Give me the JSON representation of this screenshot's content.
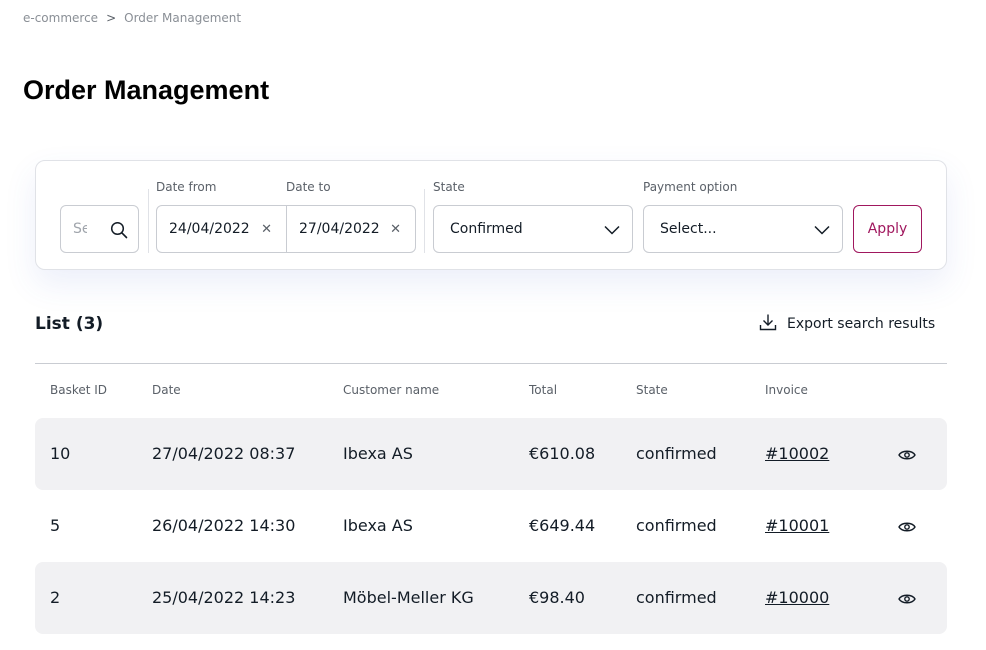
{
  "breadcrumb": {
    "items": [
      "e-commerce",
      "Order Management"
    ],
    "separator": ">"
  },
  "page": {
    "title": "Order Management"
  },
  "filters": {
    "search": {
      "placeholder": "Search"
    },
    "date_from": {
      "label": "Date from",
      "value": "24/04/2022"
    },
    "date_to": {
      "label": "Date to",
      "value": "27/04/2022"
    },
    "state": {
      "label": "State",
      "value": "Confirmed"
    },
    "payment": {
      "label": "Payment option",
      "value": "Select..."
    },
    "apply_label": "Apply"
  },
  "list": {
    "title": "List (3)",
    "export_label": "Export search results",
    "columns": [
      "Basket ID",
      "Date",
      "Customer name",
      "Total",
      "State",
      "Invoice"
    ],
    "rows": [
      {
        "basket_id": "10",
        "date": "27/04/2022 08:37",
        "customer": "Ibexa AS",
        "total": "€610.08",
        "state": "confirmed",
        "invoice": "#10002"
      },
      {
        "basket_id": "5",
        "date": "26/04/2022 14:30",
        "customer": "Ibexa AS",
        "total": "€649.44",
        "state": "confirmed",
        "invoice": "#10001"
      },
      {
        "basket_id": "2",
        "date": "25/04/2022 14:23",
        "customer": "Möbel-Meller KG",
        "total": "€98.40",
        "state": "confirmed",
        "invoice": "#10000"
      }
    ]
  },
  "colors": {
    "accent": "#a0175e",
    "row_shade": "#f1f1f3",
    "text": "#131c26",
    "muted": "#5a6068"
  }
}
